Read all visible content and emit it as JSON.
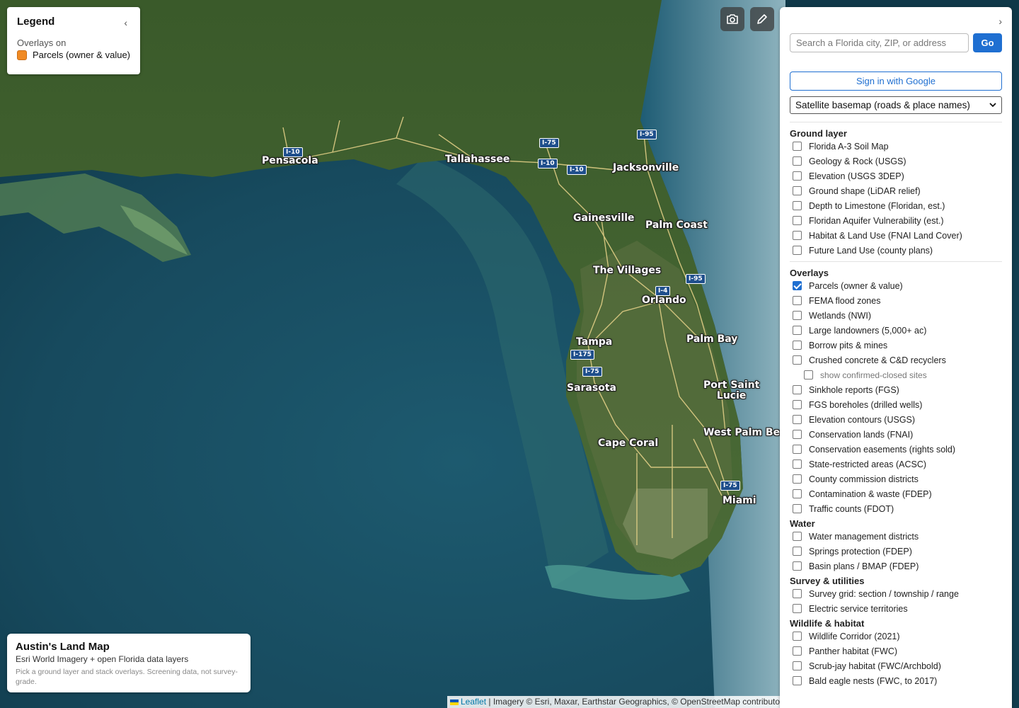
{
  "legend": {
    "title": "Legend",
    "collapse_glyph": "‹",
    "subtitle": "Overlays on",
    "items": [
      {
        "label": "Parcels (owner & value)",
        "color": "#f08a24"
      }
    ]
  },
  "map": {
    "cities": [
      "Pensacola",
      "Tallahassee",
      "Jacksonville",
      "Gainesville",
      "Palm Coast",
      "The Villages",
      "Orlando",
      "Tampa",
      "Palm Bay",
      "Sarasota",
      "Port Saint\nLucie",
      "West Palm Beach",
      "Cape Coral",
      "Miami"
    ],
    "shields": [
      "I-10",
      "I-75",
      "I-95",
      "I-10",
      "I-10",
      "I-95",
      "I-4",
      "I-175",
      "I-75",
      "I-75"
    ],
    "tools": {
      "camera_icon": "camera-icon",
      "pencil_icon": "pencil-icon"
    }
  },
  "info_box": {
    "title": "Austin's Land Map",
    "subtitle": "Esri World Imagery + open Florida data layers",
    "note": "Pick a ground layer and stack overlays. Screening data, not survey-grade."
  },
  "attribution": {
    "leaflet": "Leaflet",
    "text": " | Imagery © Esri, Maxar, Earthstar Geographics, © OpenStreetMap contributors"
  },
  "panel": {
    "expand_glyph": "›",
    "search": {
      "placeholder": "Search a Florida city, ZIP, or address",
      "go_label": "Go"
    },
    "google_label": "Sign in with Google",
    "basemap_value": "Satellite basemap (roads & place names)",
    "sections": {
      "ground": "Ground layer",
      "overlays": "Overlays",
      "water": "Water",
      "survey": "Survey & utilities",
      "wildlife": "Wildlife & habitat"
    },
    "ground_layers": [
      "Florida A-3 Soil Map",
      "Geology & Rock (USGS)",
      "Elevation (USGS 3DEP)",
      "Ground shape (LiDAR relief)",
      "Depth to Limestone (Floridan, est.)",
      "Floridan Aquifer Vulnerability (est.)",
      "Habitat & Land Use (FNAI Land Cover)",
      "Future Land Use (county plans)"
    ],
    "overlays": [
      "Parcels (owner & value)",
      "FEMA flood zones",
      "Wetlands (NWI)",
      "Large landowners (5,000+ ac)",
      "Borrow pits & mines",
      "Crushed concrete & C&D recyclers",
      "show confirmed-closed sites",
      "Sinkhole reports (FGS)",
      "FGS boreholes (drilled wells)",
      "Elevation contours (USGS)",
      "Conservation lands (FNAI)",
      "Conservation easements (rights sold)",
      "State-restricted areas (ACSC)",
      "County commission districts",
      "Contamination & waste (FDEP)",
      "Traffic counts (FDOT)"
    ],
    "water": [
      "Water management districts",
      "Springs protection (FDEP)",
      "Basin plans / BMAP (FDEP)"
    ],
    "survey": [
      "Survey grid: section / township / range",
      "Electric service territories"
    ],
    "wildlife": [
      "Wildlife Corridor (2021)",
      "Panther habitat (FWC)",
      "Scrub-jay habitat (FWC/Archbold)",
      "Bald eagle nests (FWC, to 2017)"
    ]
  }
}
